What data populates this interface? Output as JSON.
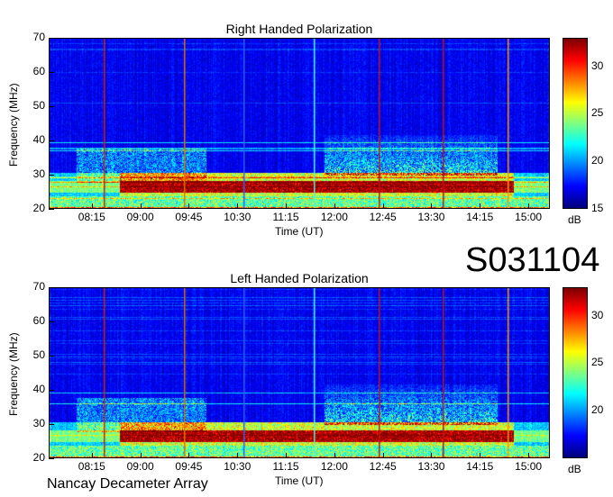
{
  "obs_id": "S031104",
  "credit": "Nancay Decameter Array",
  "colorbar_unit": "dB",
  "chart_data": [
    {
      "type": "heatmap",
      "title": "Right Handed Polarization",
      "xlabel": "Time (UT)",
      "ylabel": "Frequency (MHz)",
      "x_ticks": [
        "08:15",
        "09:00",
        "09:45",
        "10:30",
        "11:15",
        "12:00",
        "12:45",
        "13:30",
        "14:15",
        "15:00"
      ],
      "x_range": [
        "07:35",
        "15:20"
      ],
      "ylim": [
        20,
        70
      ],
      "y_ticks": [
        20,
        30,
        40,
        50,
        60,
        70
      ],
      "zlim": [
        15,
        33
      ],
      "z_ticks": [
        15,
        20,
        25,
        30
      ],
      "colorscale": "jet"
    },
    {
      "type": "heatmap",
      "title": "Left Handed Polarization",
      "xlabel": "Time (UT)",
      "ylabel": "Frequency (MHz)",
      "x_ticks": [
        "08:15",
        "09:00",
        "09:45",
        "10:30",
        "11:15",
        "12:00",
        "12:45",
        "13:30",
        "14:15",
        "15:00"
      ],
      "x_range": [
        "07:35",
        "15:20"
      ],
      "ylim": [
        20,
        70
      ],
      "y_ticks": [
        20,
        30,
        40,
        50,
        60,
        70
      ],
      "zlim": [
        15,
        33
      ],
      "z_ticks": [
        20,
        25,
        30
      ],
      "colorscale": "jet"
    }
  ]
}
